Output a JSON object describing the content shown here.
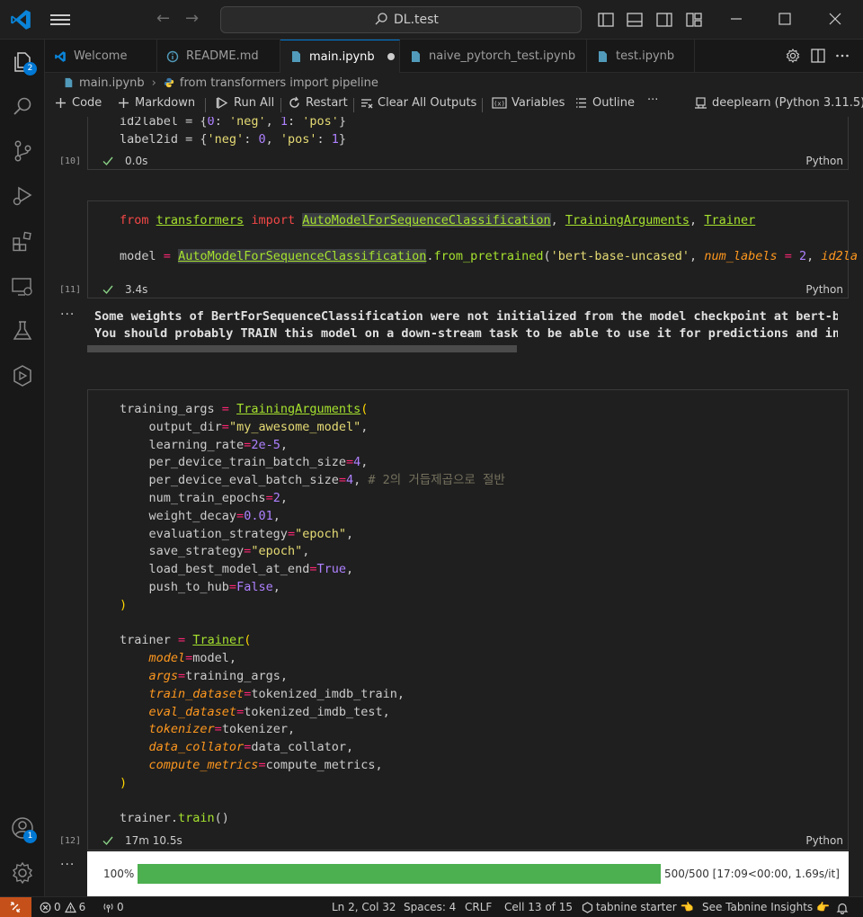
{
  "window": {
    "search_text": "DL.test"
  },
  "tabs": [
    {
      "label": "Welcome"
    },
    {
      "label": "README.md"
    },
    {
      "label": "main.ipynb"
    },
    {
      "label": "naive_pytorch_test.ipynb"
    },
    {
      "label": "test.ipynb"
    }
  ],
  "breadcrumb": {
    "file": "main.ipynb",
    "symbol": "from transformers import pipeline"
  },
  "toolbar": {
    "code": "Code",
    "markdown": "Markdown",
    "run_all": "Run All",
    "restart": "Restart",
    "clear_outputs": "Clear All Outputs",
    "variables": "Variables",
    "outline": "Outline",
    "more": "···",
    "kernel": "deeplearn (Python 3.11.5)"
  },
  "badges": {
    "explorer": "2",
    "accounts": "1"
  },
  "cells": [
    {
      "count": "[10]",
      "duration": "0.0s",
      "language": "Python"
    },
    {
      "count": "[11]",
      "duration": "3.4s",
      "language": "Python"
    },
    {
      "count": "[12]",
      "duration": "17m 10.5s",
      "language": "Python"
    }
  ],
  "output": {
    "more": "···",
    "line1": "Some weights of BertForSequenceClassification were not initialized from the model checkpoint at bert-ba",
    "line2": "You should probably TRAIN this model on a down-stream task to be able to use it for predictions and inf"
  },
  "progress": {
    "percent_label": "100%",
    "fraction": 1.0,
    "stats": "500/500 [17:09<00:00, 1.69s/it]"
  },
  "statusbar": {
    "errors": "0",
    "warnings": "6",
    "ports": "0",
    "position": "Ln 2, Col 32",
    "spaces": "Spaces: 4",
    "eol": "CRLF",
    "cell": "Cell 13 of 15",
    "tabnine": "tabnine starter 👈",
    "insights": "See Tabnine Insights 👉"
  },
  "colors": {
    "accent": "#0078d4",
    "remote": "#c5501a",
    "progress": "#4caf50"
  }
}
